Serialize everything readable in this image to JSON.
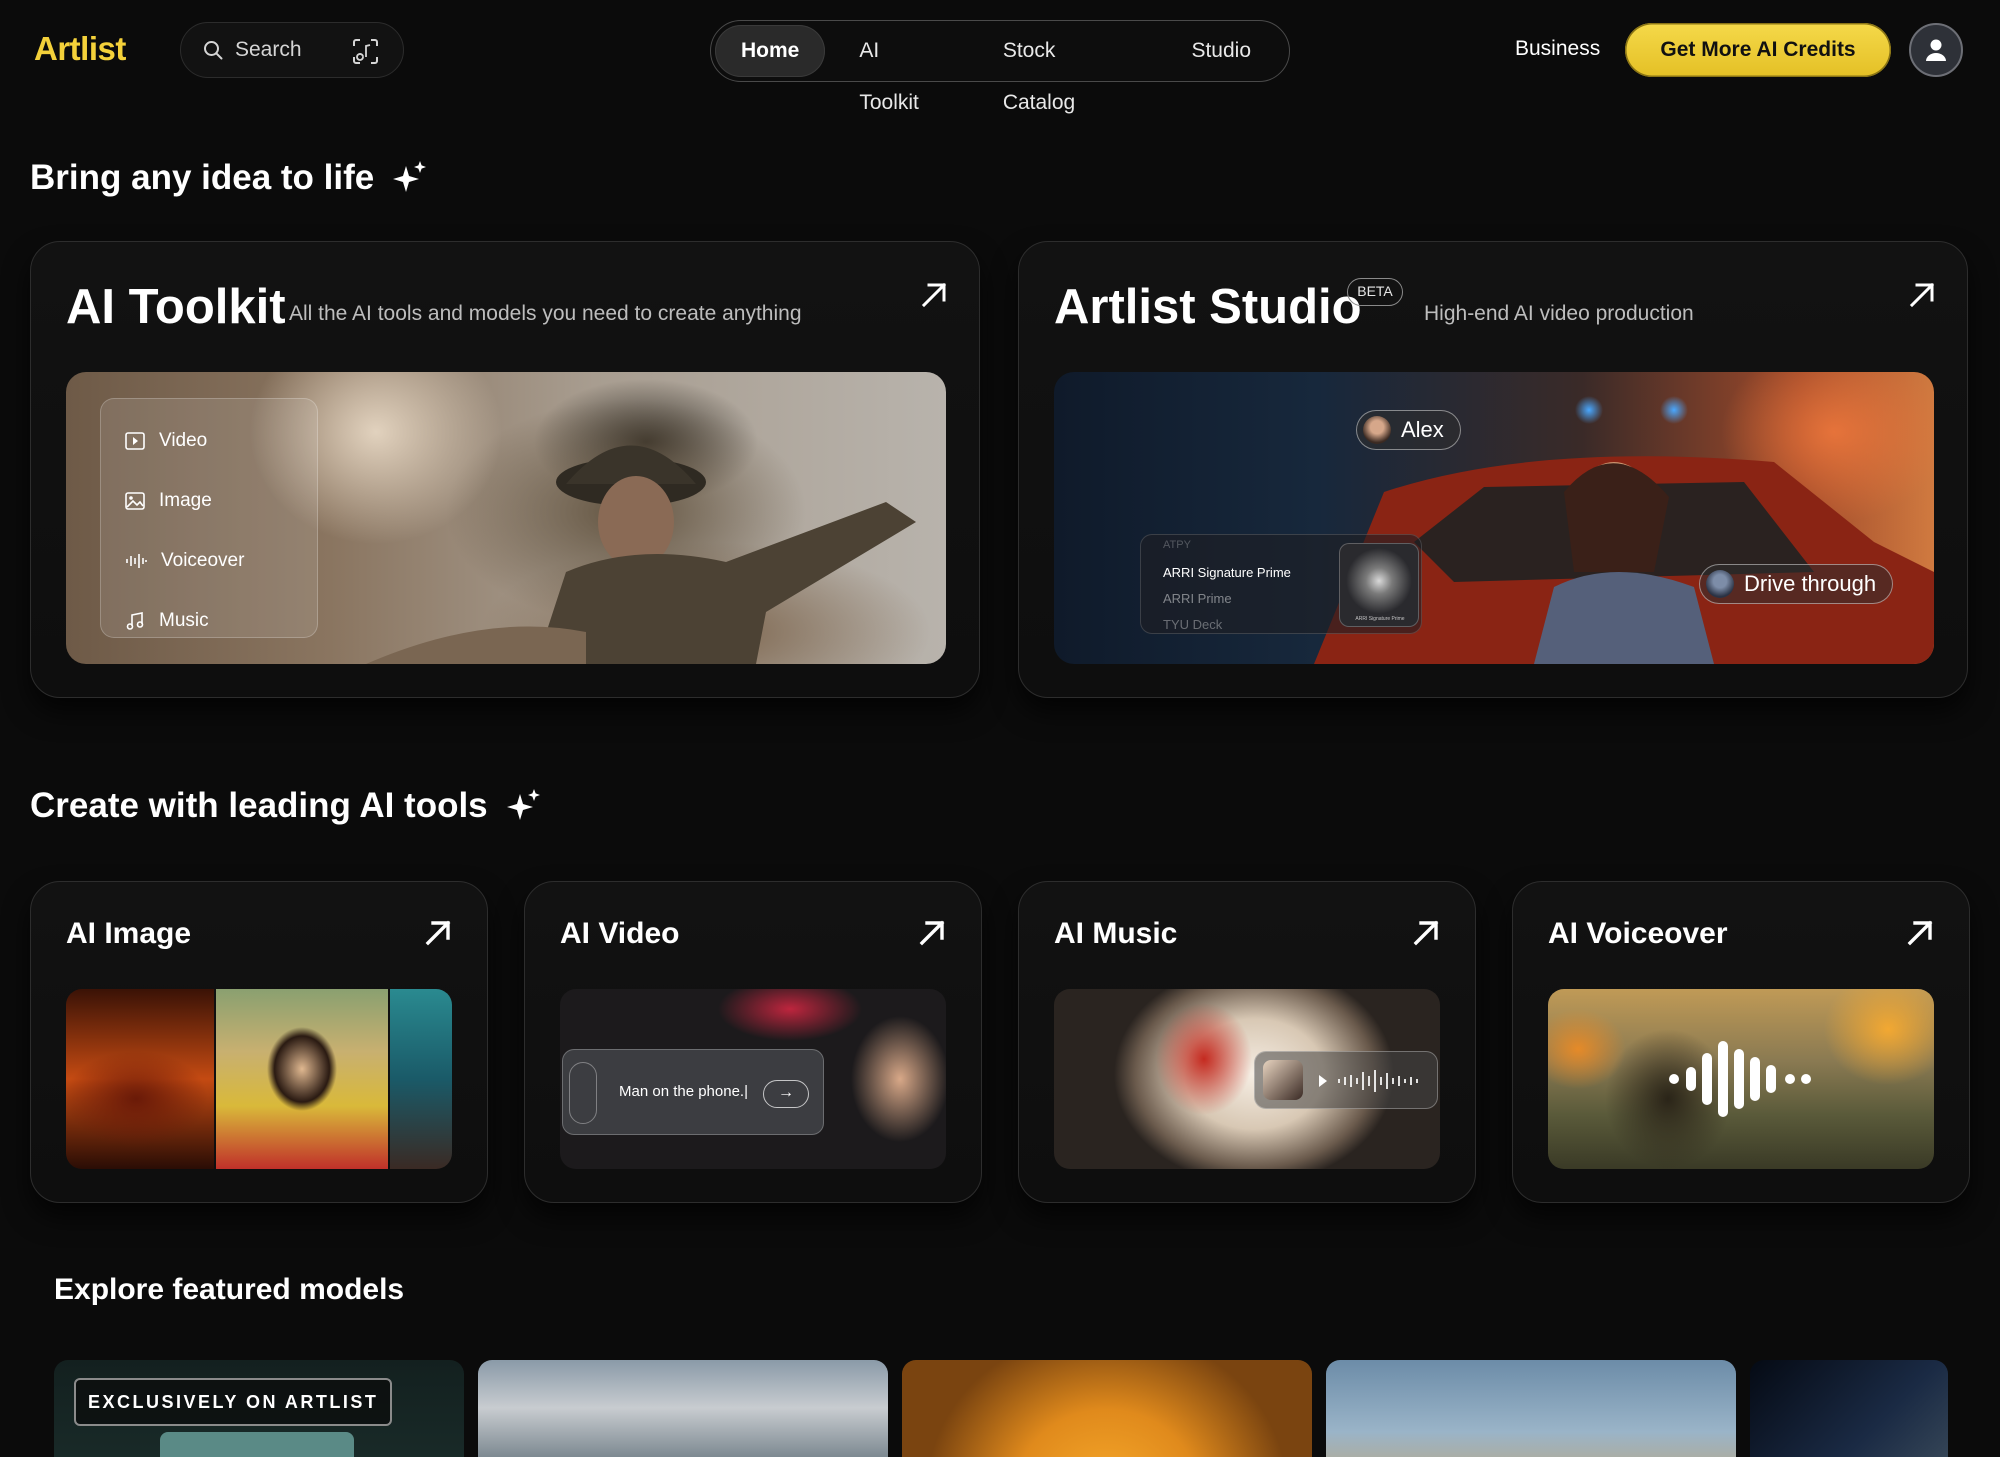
{
  "header": {
    "logo": "Artlist",
    "search_label": "Search",
    "nav_tabs": [
      "Home",
      "AI Toolkit",
      "Stock Catalog",
      "Studio"
    ],
    "active_tab": "Home",
    "business_label": "Business",
    "credits_button": "Get More AI Credits"
  },
  "hero": {
    "title": "Bring any idea to life",
    "toolkit": {
      "title": "AI Toolkit",
      "subtitle": "All the AI tools and models you need to create anything",
      "menu_items": [
        "Video",
        "Image",
        "Voiceover",
        "Music"
      ]
    },
    "studio": {
      "title": "Artlist Studio",
      "badge": "BETA",
      "subtitle": "High-end AI video production",
      "character_tag": "Alex",
      "scene_tag": "Drive through",
      "lens_options": [
        "ATPY",
        "ARRI Signature Prime",
        "ARRI Prime",
        "TYU Deck"
      ],
      "lens_caption": "ARRI Signature Prime"
    }
  },
  "tools": {
    "title": "Create with leading AI tools",
    "cards": [
      {
        "title": "AI Image"
      },
      {
        "title": "AI Video",
        "prompt_text": "Man on the phone.|"
      },
      {
        "title": "AI Music"
      },
      {
        "title": "AI Voiceover"
      }
    ]
  },
  "featured": {
    "title": "Explore featured models",
    "exclusive_label": "EXCLUSIVELY ON ARTLIST"
  },
  "colors": {
    "background": "#0b0b0b",
    "accent": "#f4d13a"
  }
}
